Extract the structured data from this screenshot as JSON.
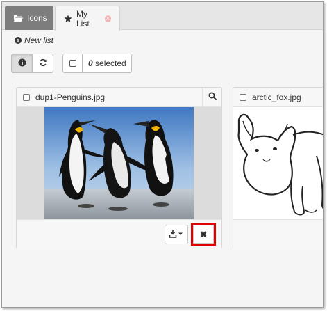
{
  "tabs": [
    {
      "label": "Icons",
      "icon": "folder-open-icon",
      "active": false
    },
    {
      "label": "My List",
      "icon": "star-icon",
      "active": true
    }
  ],
  "list": {
    "name": "New list",
    "selected_count": "0",
    "selected_label": "selected"
  },
  "cards": [
    {
      "filename": "dup1-Penguins.jpg",
      "image": "penguins-photo"
    },
    {
      "filename": "arctic_fox.jpg",
      "image": "arctic-fox-drawing"
    }
  ],
  "colors": {
    "highlight": "#e00000",
    "tab_inactive": "#7d7d7d",
    "tab_close": "#f4b6b6"
  }
}
